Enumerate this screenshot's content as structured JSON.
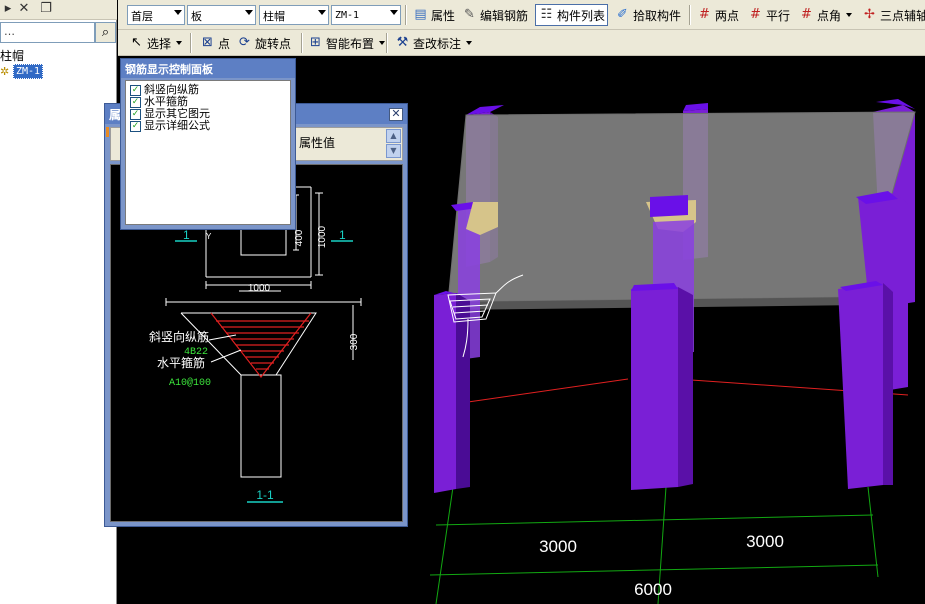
{
  "left_tree": {
    "search_placeholder": "…",
    "category": "柱帽",
    "selected_item": "ZM-1"
  },
  "toolbar1": {
    "floor_select": "首层",
    "type_select": "板",
    "component_select": "柱帽",
    "name_select": "ZM-1",
    "btn_properties": "属性",
    "btn_edit_rebar": "编辑钢筋",
    "btn_component_list": "构件列表",
    "btn_pick_component": "拾取构件",
    "btn_two_point": "两点",
    "btn_parallel": "平行",
    "btn_point_angle": "点角",
    "btn_three_point_aux": "三点辅轴"
  },
  "toolbar2": {
    "btn_select": "选择",
    "btn_point": "点",
    "btn_rotate_point": "旋转点",
    "btn_smart_layout": "智能布置",
    "btn_modify_annotation": "查改标注"
  },
  "property_panel": {
    "title": "属",
    "column_value": "属性值",
    "close_glyph": "✕"
  },
  "rebar_panel": {
    "title": "钢筋显示控制面板",
    "options": [
      {
        "label": "斜竖向纵筋",
        "checked": true
      },
      {
        "label": "水平箍筋",
        "checked": true
      },
      {
        "label": "显示其它图元",
        "checked": true
      },
      {
        "label": "显示详细公式",
        "checked": true
      }
    ]
  },
  "detail_drawing": {
    "dim_top_width": "1000",
    "dim_top_height": "1000",
    "dim_inner_height": "400",
    "axis_mark_left": "1",
    "axis_mark_right": "1",
    "axis_y_label": "Y",
    "dim_depth": "300",
    "label_vertical_rebar": "斜竖向纵筋",
    "value_vertical_rebar": "4B22",
    "label_horizontal_stirrup": "水平箍筋",
    "value_horizontal_stirrup": "A10@100",
    "section_label": "1-1"
  },
  "viewport": {
    "dim_left": "3000",
    "dim_right": "3000",
    "dim_total": "6000",
    "colors": {
      "column": "#7a1fd6",
      "column_top": "#6a10e8",
      "slab": "#8c8c8c",
      "cap": "#d6c48a",
      "grid": "#12a812",
      "axis_red": "#e02020"
    }
  }
}
